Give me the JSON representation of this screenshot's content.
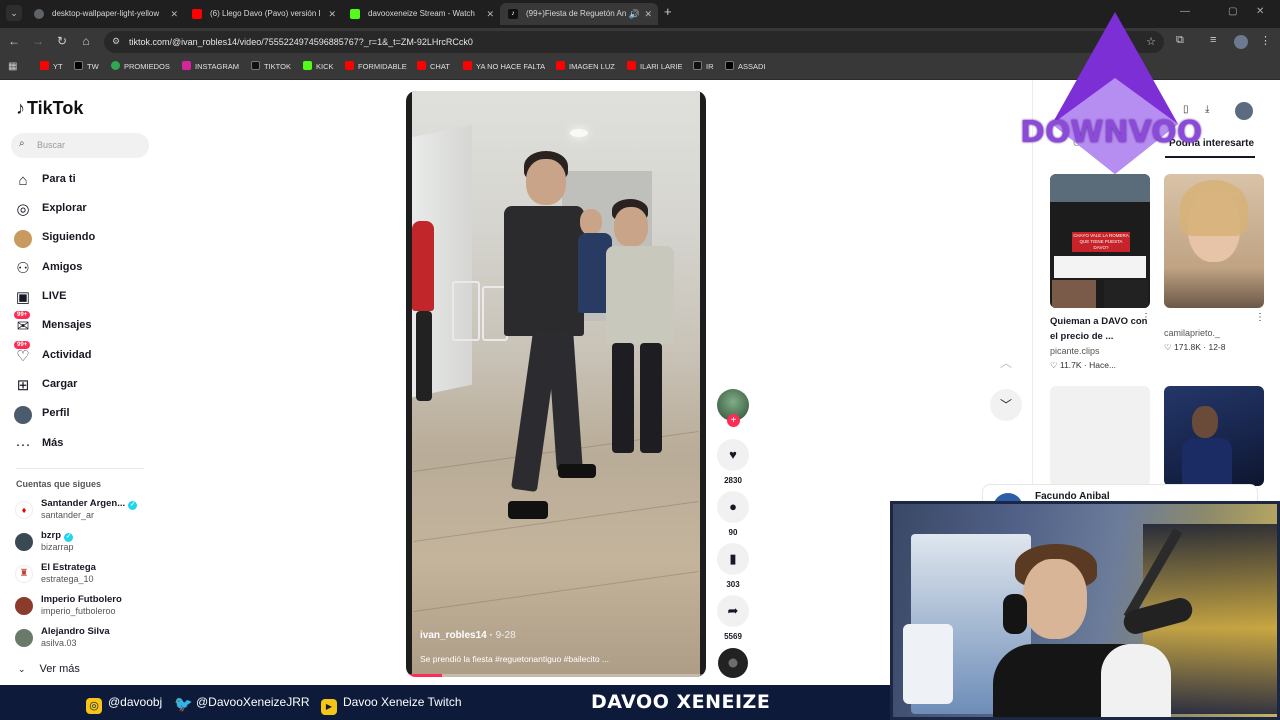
{
  "browser": {
    "tabs": [
      {
        "label": "desktop-wallpaper-light-yellow",
        "color": "#5f6368"
      },
      {
        "label": "(6) Llego Davo (Pavo) versión D",
        "color": "#ff0000"
      },
      {
        "label": "davooxeneize Stream - Watch",
        "color": "#53fc18"
      },
      {
        "label": "(99+)Fiesta de Reguetón An",
        "color": "#111111"
      }
    ],
    "url": "tiktok.com/@ivan_robles14/video/7555224974596885767?_r=1&_t=ZM-92LHrcRCck0",
    "bookmarks": [
      {
        "label": "YT",
        "color": "#ff0000"
      },
      {
        "label": "TW",
        "color": "#000000"
      },
      {
        "label": "PROMIEDOS",
        "color": "#2fa84f"
      },
      {
        "label": "INSTAGRAM",
        "color": "#d6249f"
      },
      {
        "label": "TIKTOK",
        "color": "#111111"
      },
      {
        "label": "KICK",
        "color": "#53fc18"
      },
      {
        "label": "FORMIDABLE",
        "color": "#ff0000"
      },
      {
        "label": "CHAT",
        "color": "#ff0000"
      },
      {
        "label": "YA NO HACE FALTA",
        "color": "#ff0000"
      },
      {
        "label": "IMAGEN LUZ",
        "color": "#ff0000"
      },
      {
        "label": "ILARI LARIE",
        "color": "#ff0000"
      },
      {
        "label": "IR",
        "color": "#111111"
      },
      {
        "label": "ASSADI",
        "color": "#000000"
      }
    ]
  },
  "tiktok": {
    "logo": "TikTok",
    "search_placeholder": "Buscar",
    "nav": [
      {
        "label": "Para ti",
        "icon": "home-icon"
      },
      {
        "label": "Explorar",
        "icon": "compass-icon"
      },
      {
        "label": "Siguiendo",
        "icon": "following-avatar-icon"
      },
      {
        "label": "Amigos",
        "icon": "friends-icon"
      },
      {
        "label": "LIVE",
        "icon": "live-icon"
      },
      {
        "label": "Mensajes",
        "icon": "messages-icon",
        "badge": "99+"
      },
      {
        "label": "Actividad",
        "icon": "activity-icon",
        "badge": "99+"
      },
      {
        "label": "Cargar",
        "icon": "upload-icon"
      },
      {
        "label": "Perfil",
        "icon": "profile-icon"
      },
      {
        "label": "Más",
        "icon": "more-icon"
      }
    ],
    "following_header": "Cuentas que sigues",
    "following": [
      {
        "name": "Santander Argen...",
        "user": "santander_ar",
        "verified": true,
        "color": "#ec0000"
      },
      {
        "name": "bzrp",
        "user": "bizarrap",
        "verified": true,
        "color": "#3a4a55"
      },
      {
        "name": "El Estratega",
        "user": "estratega_10",
        "verified": false,
        "color": "#c0392b"
      },
      {
        "name": "Imperio Futbolero",
        "user": "imperio_futboleroo",
        "verified": false,
        "color": "#8a3b2c"
      },
      {
        "name": "Alejandro Silva",
        "user": "asilva.03",
        "verified": false,
        "color": "#6a7a6a"
      }
    ],
    "see_more": "Ver más",
    "video": {
      "username": "ivan_robles14",
      "date": "9-28",
      "caption": "Se prendió la fiesta #reguetonantiguo #bailecito ...",
      "progress": 0.12
    },
    "actions": [
      {
        "icon": "heart-icon",
        "count": "2830"
      },
      {
        "icon": "comment-icon",
        "count": "90"
      },
      {
        "icon": "bookmark-icon",
        "count": "303"
      },
      {
        "icon": "share-icon",
        "count": "5569"
      }
    ],
    "right_panel": {
      "tab_left": "C",
      "tab_right": "Podría interesarte",
      "cards": [
        {
          "title": "Quieman a DAVO con el precio de ...",
          "author": "picante.clips",
          "stats": "11.7K · Hace..."
        },
        {
          "title": "",
          "author": "camilaprieto._",
          "stats": "171.8K · 12-8"
        }
      ],
      "thumb_overlay": "CHAYO VALE LA ROMERA QUE TIENE PUESTA DAVO?"
    },
    "notification_name": "Facundo Anibal"
  },
  "overlay": {
    "watermark": "DOWNVOO",
    "footer": [
      {
        "label": "@davoobj",
        "icon": "instagram-icon",
        "color": "#f5c518"
      },
      {
        "label": "@DavooXeneizeJRR",
        "icon": "twitter-icon",
        "color": "#f5c518"
      },
      {
        "label": "Davoo Xeneize Twitch",
        "icon": "youtube-icon",
        "color": "#f5c518"
      }
    ],
    "brand": "DAVOO XENEIZE"
  }
}
